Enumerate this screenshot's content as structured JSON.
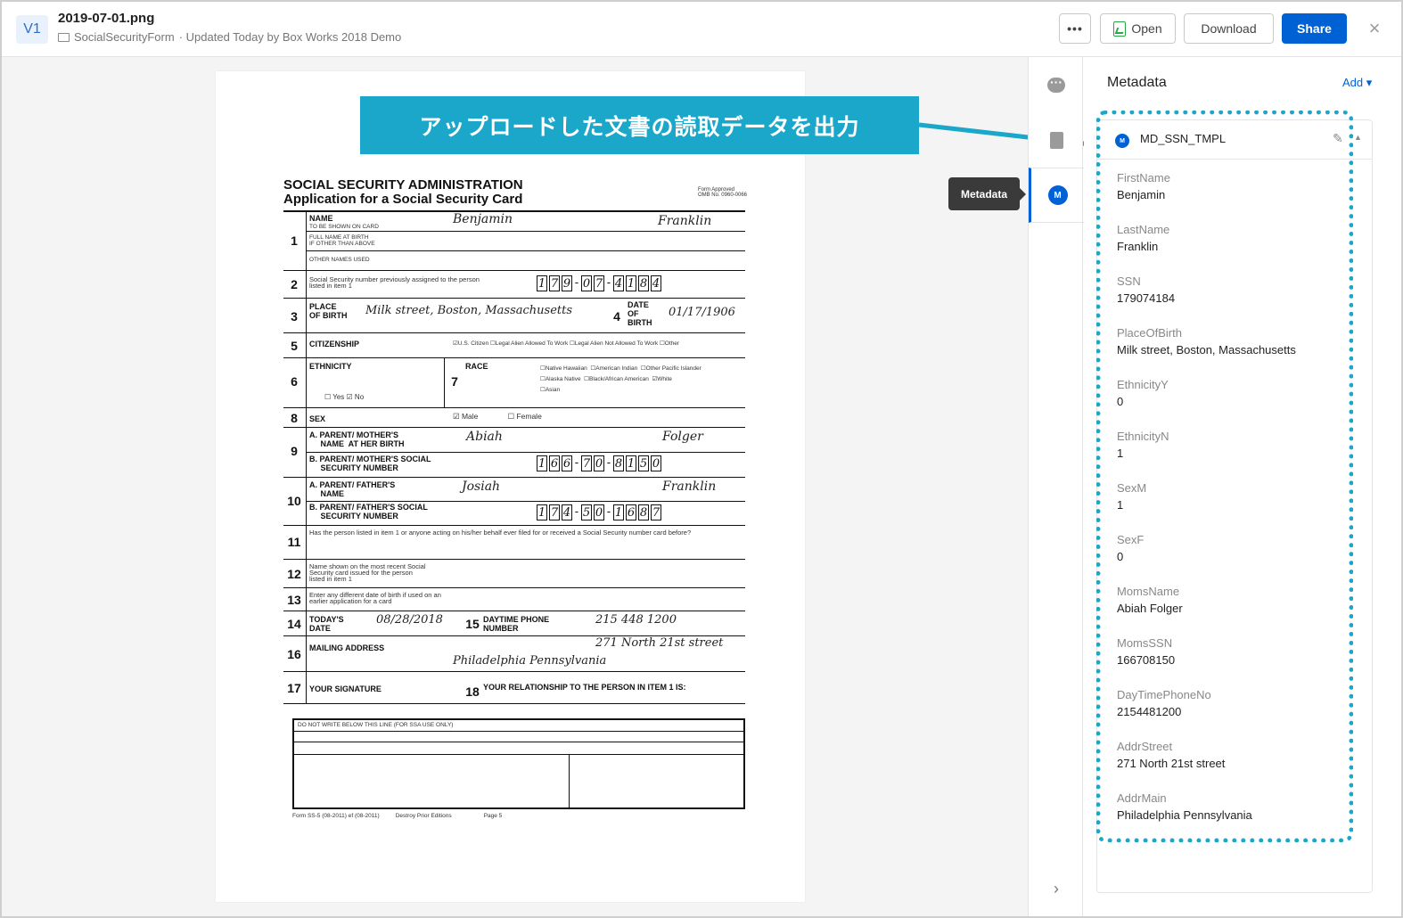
{
  "header": {
    "version_badge": "V1",
    "file_name": "2019-07-01.png",
    "folder_name": "SocialSecurityForm",
    "updated_text": "· Updated Today by Box Works 2018 Demo",
    "more_label": "•••",
    "open_label": "Open",
    "download_label": "Download",
    "share_label": "Share",
    "close_label": "×"
  },
  "banner": {
    "text": "アップロードした文書の読取データを出力"
  },
  "tooltip": {
    "text": "Metadata"
  },
  "rail": {
    "meta_icon_letter": "M",
    "chevron": "›"
  },
  "sidebar": {
    "title": "Metadata",
    "add_label": "Add ▾",
    "template_name": "MD_SSN_TMPL",
    "fields": [
      {
        "label": "FirstName",
        "value": "Benjamin"
      },
      {
        "label": "LastName",
        "value": "Franklin"
      },
      {
        "label": "SSN",
        "value": "179074184"
      },
      {
        "label": "PlaceOfBirth",
        "value": "Milk street, Boston, Massachusetts"
      },
      {
        "label": "EthnicityY",
        "value": "0"
      },
      {
        "label": "EthnicityN",
        "value": "1"
      },
      {
        "label": "SexM",
        "value": "1"
      },
      {
        "label": "SexF",
        "value": "0"
      },
      {
        "label": "MomsName",
        "value": "Abiah Folger"
      },
      {
        "label": "MomsSSN",
        "value": "166708150"
      },
      {
        "label": "DayTimePhoneNo",
        "value": "2154481200"
      },
      {
        "label": "AddrStreet",
        "value": "271 North 21st street"
      },
      {
        "label": "AddrMain",
        "value": "Philadelphia Pennsylvania"
      }
    ]
  },
  "form": {
    "title": "SOCIAL SECURITY ADMINISTRATION",
    "subtitle": "Application for a Social Security Card",
    "approved": "Form Approved\nOMB No. 0960-0066",
    "r1_name": "NAME",
    "r1_name_sub": "TO BE SHOWN ON CARD",
    "r1_birth": "FULL NAME AT BIRTH\nIF OTHER THAN ABOVE",
    "r1_other": "OTHER NAMES USED",
    "first_hand": "Benjamin",
    "last_hand": "Franklin",
    "r2_label": "Social Security number previously assigned to the person\nlisted in item 1",
    "r2_digits": [
      "1",
      "7",
      "9",
      "0",
      "7",
      "4",
      "1",
      "8",
      "4"
    ],
    "r3_label": "PLACE\nOF BIRTH",
    "r3_hand": "Milk street, Boston, Massachusetts",
    "r4_label": "DATE\nOF\nBIRTH",
    "r4_hand": "01/17/1906",
    "r5_label": "CITIZENSHIP",
    "r5_opts": "☑U.S. Citizen   ☐Legal Alien Allowed To Work   ☐Legal Alien Not Allowed To Work   ☐Other",
    "r6_label": "ETHNICITY",
    "r6_opts": "☐ Yes   ☑ No",
    "r7_label": "RACE",
    "r7_opts": "☐Native Hawaiian  ☐American Indian  ☐Other Pacific Islander\n☐Alaska Native  ☐Black/African American  ☑White\n☐Asian",
    "r8_label": "SEX",
    "r8_opts": "☑ Male              ☐ Female",
    "r9_a": "A. PARENT/ MOTHER'S\n     NAME  AT HER BIRTH",
    "r9_mom_first": "Abiah",
    "r9_mom_last": "Folger",
    "r9_b": "B. PARENT/ MOTHER'S SOCIAL\n     SECURITY NUMBER",
    "r9_digits": [
      "1",
      "6",
      "6",
      "7",
      "0",
      "8",
      "1",
      "5",
      "0"
    ],
    "r10_a": "A. PARENT/ FATHER'S\n     NAME",
    "r10_dad_first": "Josiah",
    "r10_dad_last": "Franklin",
    "r10_b": "B. PARENT/ FATHER'S SOCIAL\n     SECURITY NUMBER",
    "r10_digits": [
      "1",
      "7",
      "4",
      "5",
      "0",
      "1",
      "6",
      "8",
      "7"
    ],
    "r11_label": "Has the person listed in item 1 or anyone acting on his/her behalf ever filed for or received a Social Security number card before?",
    "r12_label": "Name shown on the most recent Social\nSecurity card issued for the person\nlisted in item 1",
    "r13_label": "Enter any different date of birth if used on an\nearlier application for a card",
    "r14_label": "TODAY'S\nDATE",
    "r14_hand": "08/28/2018",
    "r15_label": "DAYTIME PHONE\nNUMBER",
    "r15_hand": "215  448 1200",
    "r16_label": "MAILING ADDRESS",
    "r16_hand1": "271  North  21st  street",
    "r16_hand2": "Philadelphia      Pennsylvania",
    "r17_label": "YOUR SIGNATURE",
    "r18_label": "YOUR RELATIONSHIP TO THE PERSON IN ITEM 1 IS:",
    "ssa_head": "DO NOT WRITE BELOW THIS LINE (FOR SSA USE ONLY)",
    "footer": "Form SS-5 (08-2011) ef (08-2011)          Destroy Prior Editions                    Page 5"
  }
}
